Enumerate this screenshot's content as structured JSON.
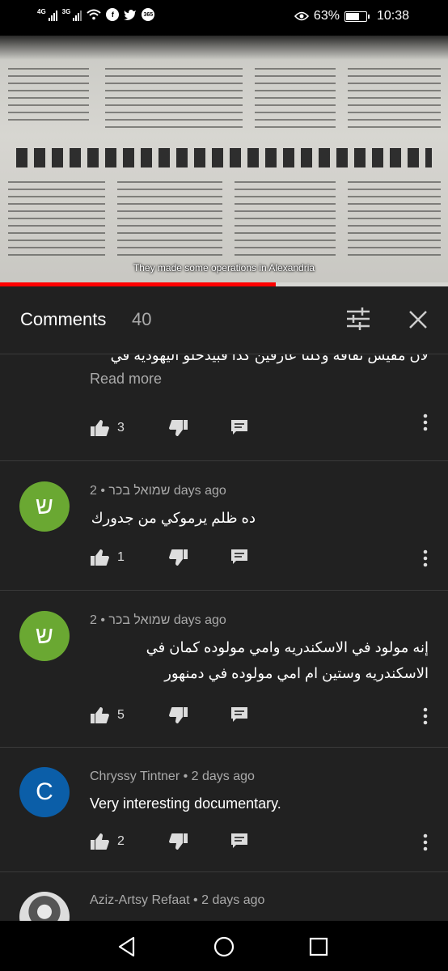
{
  "status_bar": {
    "net1": "4G",
    "net2": "3G",
    "battery_percent": "63%",
    "battery_level": 0.63,
    "time": "10:38",
    "app_icons": [
      "wifi-icon",
      "facebook-icon",
      "twitter-icon",
      "365-icon"
    ],
    "badge_365": "365"
  },
  "video": {
    "caption": "They made some operations in Alexandria",
    "progress_fraction": 0.615
  },
  "comments_header": {
    "title": "Comments",
    "count": "40"
  },
  "comments": [
    {
      "text": "لان مفيش ثقافة وكلنا عارفين كدا فبيدخلو اليهوديه في",
      "read_more": "Read more",
      "likes": "3"
    },
    {
      "avatar_letter": "ש",
      "avatar_color": "#6aa832",
      "author": "שמואל בכר",
      "time": "2 days ago",
      "text": "ده ظلم يرموكي من جدورك",
      "likes": "1"
    },
    {
      "avatar_letter": "ש",
      "avatar_color": "#6aa832",
      "author": "שמואל בכר",
      "time": "2 days ago",
      "text": "إنه مولود في الاسكندريه وامي مولوده كمان في الاسكندريه وستين ام امي مولوده في دمنهور",
      "likes": "5"
    },
    {
      "avatar_letter": "C",
      "avatar_color": "#0b5ea8",
      "author": "Chryssy Tintner",
      "time": "2 days ago",
      "text": "Very interesting documentary.",
      "likes": "2"
    },
    {
      "author": "Aziz-Artsy Refaat",
      "time": "2 days ago"
    }
  ],
  "separator": "•"
}
